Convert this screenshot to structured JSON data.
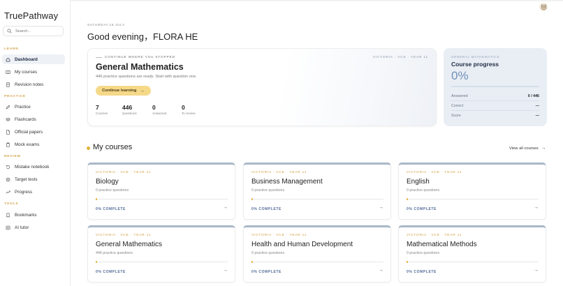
{
  "app": {
    "name": "TruePathway"
  },
  "search": {
    "placeholder": "Search..."
  },
  "sidebar": {
    "sections": [
      {
        "label": "LEARN",
        "items": [
          {
            "label": "Dashboard",
            "icon": "home-icon",
            "active": true
          },
          {
            "label": "My courses",
            "icon": "book-icon"
          },
          {
            "label": "Revision notes",
            "icon": "notes-icon"
          }
        ]
      },
      {
        "label": "PRACTICE",
        "items": [
          {
            "label": "Practice",
            "icon": "pencil-icon"
          },
          {
            "label": "Flashcards",
            "icon": "layers-icon"
          },
          {
            "label": "Official papers",
            "icon": "document-icon"
          },
          {
            "label": "Mock exams",
            "icon": "clipboard-icon"
          }
        ]
      },
      {
        "label": "REVIEW",
        "items": [
          {
            "label": "Mistake notebook",
            "icon": "undo-icon"
          },
          {
            "label": "Target tests",
            "icon": "target-icon"
          },
          {
            "label": "Progress",
            "icon": "trend-icon"
          }
        ]
      },
      {
        "label": "TOOLS",
        "items": [
          {
            "label": "Bookmarks",
            "icon": "bookmark-icon"
          },
          {
            "label": "AI tutor",
            "icon": "ai-icon"
          }
        ]
      }
    ]
  },
  "header": {
    "date": "SATURDAY,18 JULY",
    "greeting": "Good evening，FLORA HE"
  },
  "hero": {
    "kicker": "CONTINUE WHERE YOU STOPPED",
    "region": "VICTORIA · VCE · YEAR 11",
    "title": "General Mathematics",
    "description": "446 practice questions are ready. Start with question one.",
    "cta_label": "Continue learning",
    "stats": [
      {
        "value": "7",
        "label": "Courses"
      },
      {
        "value": "446",
        "label": "Questions"
      },
      {
        "value": "0",
        "label": "Answered"
      },
      {
        "value": "0",
        "label": "To review"
      }
    ]
  },
  "progress_card": {
    "kicker": "GENERAL MATHEMATICS",
    "title": "Course progress",
    "percent": "0%",
    "rows": [
      {
        "label": "Answered",
        "value": "0 / 446"
      },
      {
        "label": "Correct",
        "value": "—"
      },
      {
        "label": "Score",
        "value": "—"
      }
    ]
  },
  "my_courses": {
    "title": "My courses",
    "view_all": "View all courses",
    "accent": "#e2b23a",
    "courses": [
      {
        "tag": "VICTORIA · VCE · YEAR 11",
        "name": "Biology",
        "questions": "0 practice questions",
        "complete": "0% COMPLETE",
        "progress": 0
      },
      {
        "tag": "VICTORIA · VCE · YEAR 11",
        "name": "Business Management",
        "questions": "0 practice questions",
        "complete": "0% COMPLETE",
        "progress": 0
      },
      {
        "tag": "VICTORIA · VCE · YEAR 11",
        "name": "English",
        "questions": "0 practice questions",
        "complete": "0% COMPLETE",
        "progress": 0
      },
      {
        "tag": "VICTORIA · VCE · YEAR 11",
        "name": "General Mathematics",
        "questions": "446 practice questions",
        "complete": "0% COMPLETE",
        "progress": 0
      },
      {
        "tag": "VICTORIA · VCE · YEAR 11",
        "name": "Health and Human Development",
        "questions": "0 practice questions",
        "complete": "0% COMPLETE",
        "progress": 0
      },
      {
        "tag": "VICTORIA · VCE · YEAR 11",
        "name": "Mathematical Methods",
        "questions": "0 practice questions",
        "complete": "0% COMPLETE",
        "progress": 0
      }
    ]
  }
}
